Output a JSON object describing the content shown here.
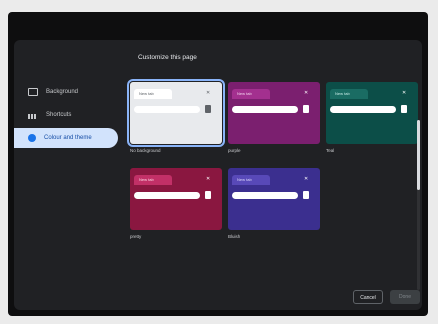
{
  "dialog": {
    "title": "Customize this page",
    "cancel_label": "Cancel",
    "done_label": "Done"
  },
  "sidebar": {
    "items": [
      {
        "label": "Background",
        "icon": "background-icon",
        "active": false
      },
      {
        "label": "Shortcuts",
        "icon": "shortcuts-icon",
        "active": false
      },
      {
        "label": "Colour and theme",
        "icon": "palette-icon",
        "active": true
      }
    ]
  },
  "themes": [
    {
      "name": "No background",
      "tab_text": "New tab",
      "selected": true,
      "frame": "#e8eaed",
      "tab_bg": "#ffffff",
      "tab_text_color": "#5f6368",
      "icon_color": "#5f6368"
    },
    {
      "name": "purple",
      "tab_text": "New tab",
      "selected": false,
      "frame": "#7b1f6f",
      "tab_bg": "#a3308f",
      "tab_text_color": "#f3d1ee",
      "icon_color": "#ffffff"
    },
    {
      "name": "Teal",
      "tab_text": "New tab",
      "selected": false,
      "frame": "#0c4e48",
      "tab_bg": "#1a6c63",
      "tab_text_color": "#c7ece7",
      "icon_color": "#ffffff"
    },
    {
      "name": "pretty",
      "tab_text": "New tab",
      "selected": false,
      "frame": "#8a1740",
      "tab_bg": "#c23067",
      "tab_text_color": "#fbd3e1",
      "icon_color": "#ffffff"
    },
    {
      "name": "Bluish",
      "tab_text": "New tab",
      "selected": false,
      "frame": "#3b2f8f",
      "tab_bg": "#5849b8",
      "tab_text_color": "#dcd7fb",
      "icon_color": "#ffffff"
    }
  ],
  "colors": {
    "accent": "#8ab4f8",
    "active_nav": "#d2e3fc",
    "dialog_bg": "#202124"
  }
}
